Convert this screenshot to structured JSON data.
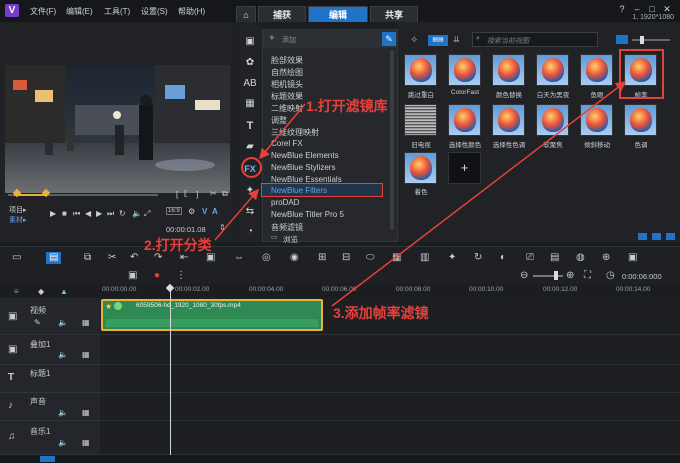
{
  "menu": [
    "文件(F)",
    "编辑(E)",
    "工具(T)",
    "设置(S)",
    "帮助(H)"
  ],
  "tabs": {
    "capture": "捕获",
    "edit": "编辑",
    "share": "共享"
  },
  "resolution": "1, 1920*1080",
  "preview": {
    "project_label": "项目▸",
    "clip_label": "素材▸",
    "timecode": "00:00:01.08",
    "ratio": "16:9"
  },
  "filters_header": {
    "add_label": "添加"
  },
  "categories": [
    "脸部效果",
    "自然绘图",
    "相机镜头",
    "标题效果",
    "二维映射",
    "调整",
    "三维纹理映射",
    "Corel FX",
    "NewBlue Elements",
    "NewBlue Stylizers",
    "NewBlue Essentials",
    "NewBlue Filters",
    "proDAD",
    "NewBlue Titler Pro 5",
    "音频滤镜"
  ],
  "browse_label": "浏览",
  "library": {
    "search_placeholder": "搜索当前视图",
    "items": [
      "跳过重白",
      "ColorFast",
      "颜色替换",
      "白天为黑夜",
      "鱼眼",
      "帧率",
      "旧电视",
      "选择性颜色",
      "选择性色调",
      "软聚焦",
      "倾斜移动",
      "色调",
      "着色"
    ]
  },
  "timeline": {
    "zoom_time": "0:00:06:000",
    "ruler": [
      "00:00:00.00",
      "00:00:02.00",
      "00:00:04.00",
      "00:00:06.00",
      "00:00:08.00",
      "00:00:10.00",
      "00:00:12.00",
      "00:00:14.00"
    ],
    "tracks": [
      "视频",
      "叠加1",
      "标题1",
      "声音",
      "音乐1"
    ],
    "clip_name": "6059506-hd_1920_1080_30fps.mp4"
  },
  "annotations": {
    "step1": "1.打开滤镜库",
    "step2": "2.打开分类",
    "step3": "3.添加帧率滤镜"
  },
  "colors": {
    "accent": "#1f74c8",
    "highlight": "#e8403a",
    "clip": "#2e8a52"
  }
}
